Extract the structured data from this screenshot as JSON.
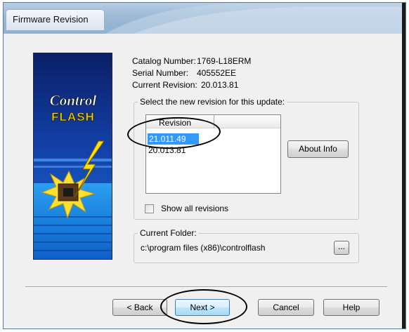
{
  "window": {
    "title": "Firmware Revision"
  },
  "logo": {
    "line1": "Control",
    "line2": "FLASH"
  },
  "info": {
    "catalog_label": "Catalog Number:",
    "catalog_value": "1769-L18ERM",
    "serial_label": "Serial Number:",
    "serial_value": "405552EE",
    "current_label": "Current Revision:",
    "current_value": "20.013.81"
  },
  "revision_group": {
    "legend": "Select the new revision for this update:",
    "column_header": "Revision",
    "revisions": [
      "21.011.49",
      "20.013.81"
    ],
    "selected_index": 0,
    "about_button": "About Info",
    "show_all_label": "Show all revisions",
    "show_all_checked": false
  },
  "folder_group": {
    "legend": "Current Folder:",
    "path": "c:\\program files (x86)\\controlflash",
    "browse_button": "..."
  },
  "buttons": {
    "back": "< Back",
    "next": "Next >",
    "cancel": "Cancel",
    "help": "Help"
  },
  "colors": {
    "selection": "#3399ff",
    "title_bar": "#9db9d5",
    "logo_background": "#0b2a78",
    "logo_text_yellow": "#ffe000"
  }
}
